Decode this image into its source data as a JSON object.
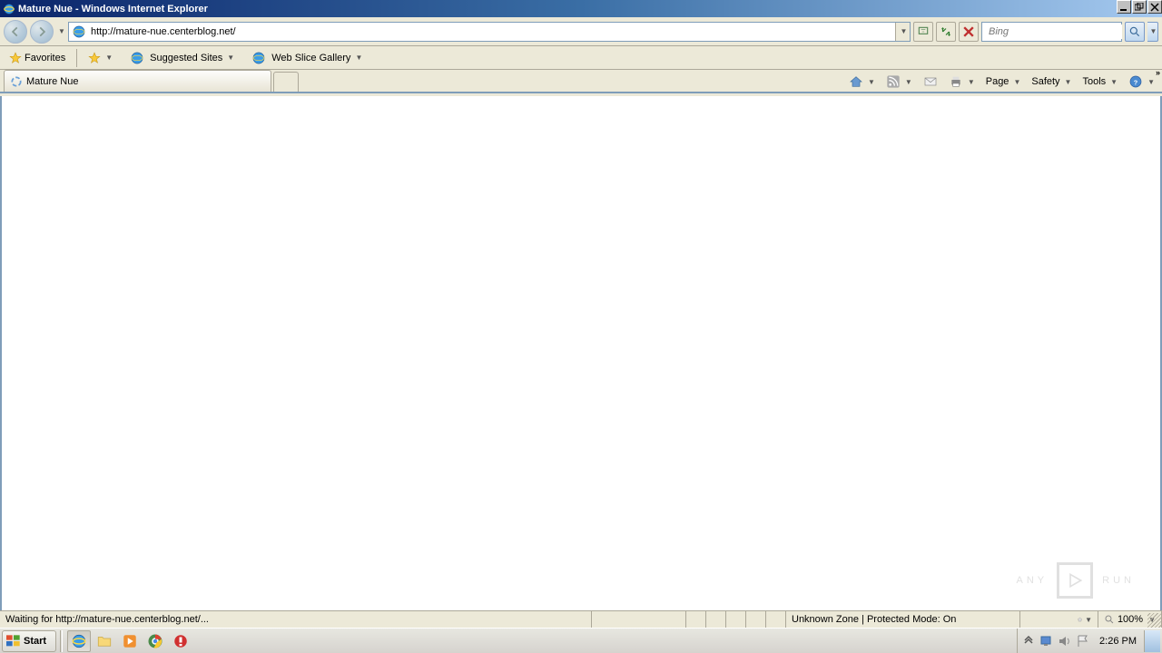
{
  "window": {
    "title": "Mature Nue - Windows Internet Explorer"
  },
  "nav": {
    "url": "http://mature-nue.centerblog.net/",
    "search_placeholder": "Bing"
  },
  "favorites": {
    "label": "Favorites",
    "suggested": "Suggested Sites",
    "webslice": "Web Slice Gallery"
  },
  "tab": {
    "title": "Mature Nue"
  },
  "commands": {
    "page": "Page",
    "safety": "Safety",
    "tools": "Tools"
  },
  "status": {
    "loading": "Waiting for http://mature-nue.centerblog.net/...",
    "zone": "Unknown Zone | Protected Mode: On",
    "zoom": "100%"
  },
  "taskbar": {
    "start": "Start",
    "clock": "2:26 PM"
  },
  "watermark": {
    "left": "ANY",
    "right": "RUN"
  }
}
